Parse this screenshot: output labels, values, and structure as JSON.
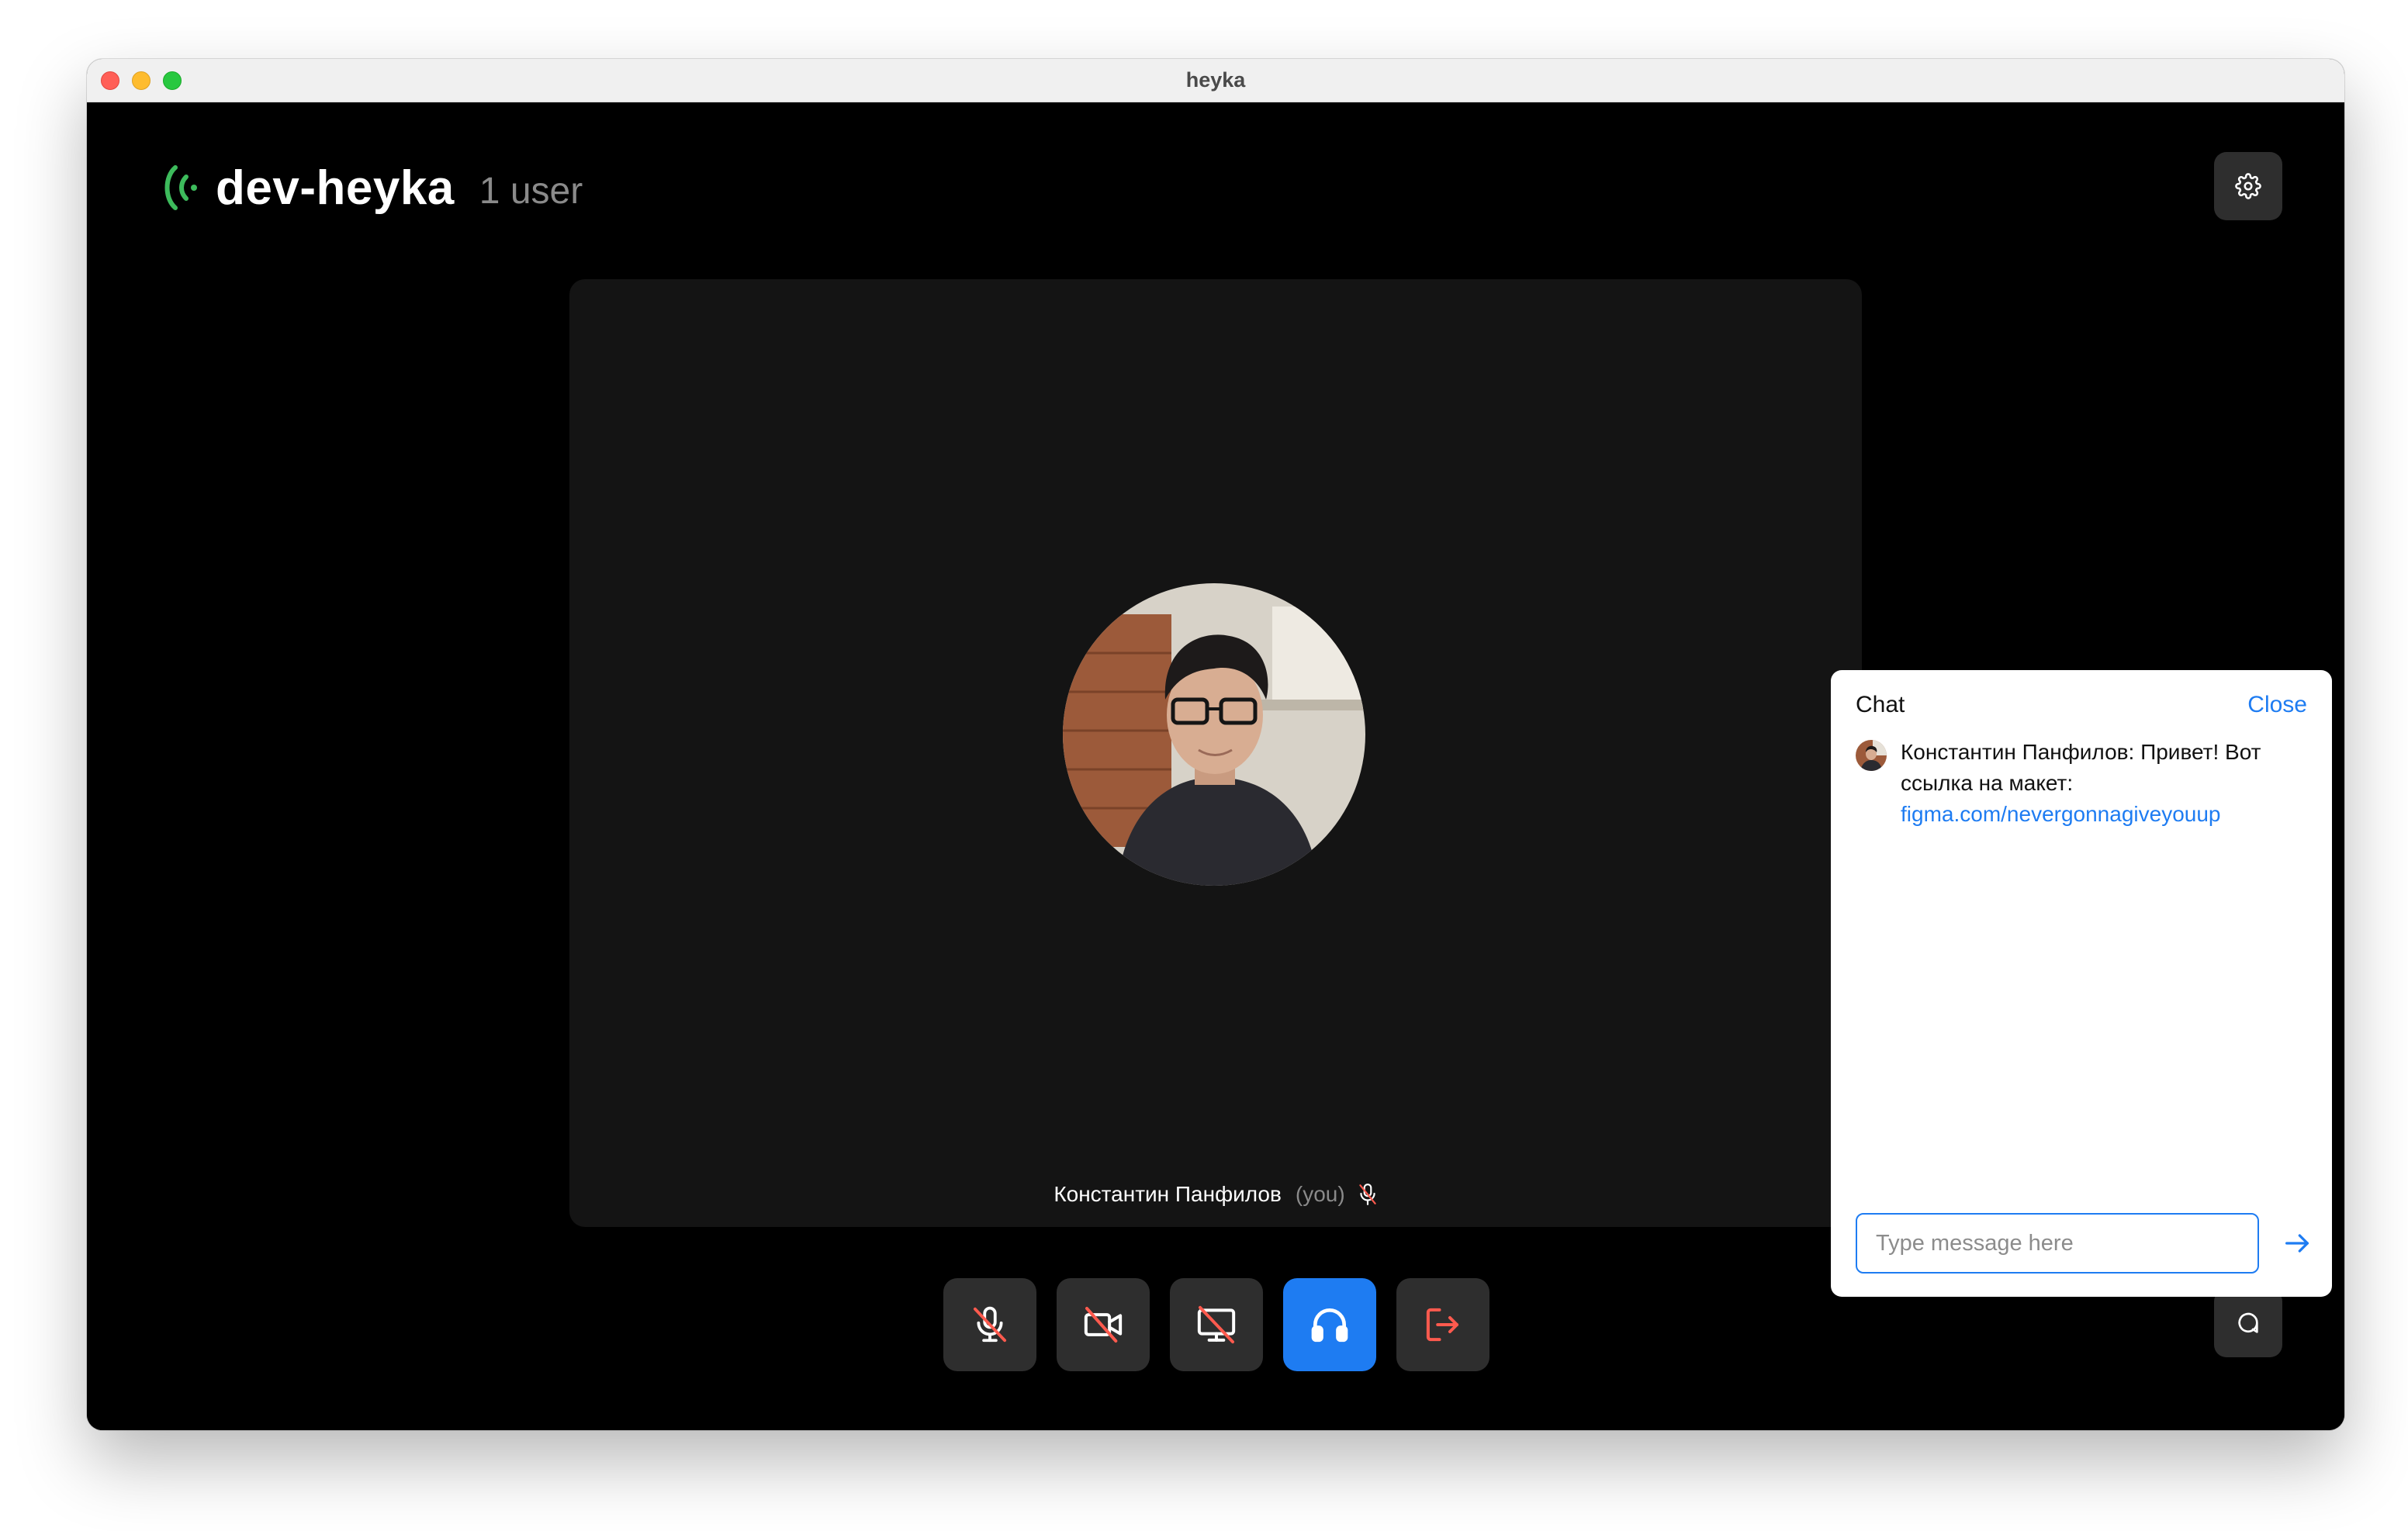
{
  "window": {
    "title": "heyka"
  },
  "room": {
    "name": "dev-heyka",
    "user_count": "1 user"
  },
  "participant": {
    "name": "Константин Панфилов",
    "you_label": "(you)"
  },
  "controls": [
    {
      "icon": "mic-off-icon",
      "state": "off"
    },
    {
      "icon": "camera-off-icon",
      "state": "off"
    },
    {
      "icon": "screen-share-off-icon",
      "state": "off"
    },
    {
      "icon": "headphones-icon",
      "state": "on"
    },
    {
      "icon": "leave-icon",
      "state": "action"
    }
  ],
  "chat": {
    "title": "Chat",
    "close_label": "Close",
    "messages": [
      {
        "author": "Константин Панфилов:",
        "text": "Привет! Вот ссылка на макет:",
        "link": "figma.com/nevergonnagiveyouup"
      }
    ],
    "input_placeholder": "Type message here"
  },
  "colors": {
    "accent": "#1e7cf2",
    "signal": "#3dbb5c",
    "danger": "#ff5a4e",
    "background": "#000000",
    "tile": "#141414",
    "button": "#2e2e2e"
  }
}
